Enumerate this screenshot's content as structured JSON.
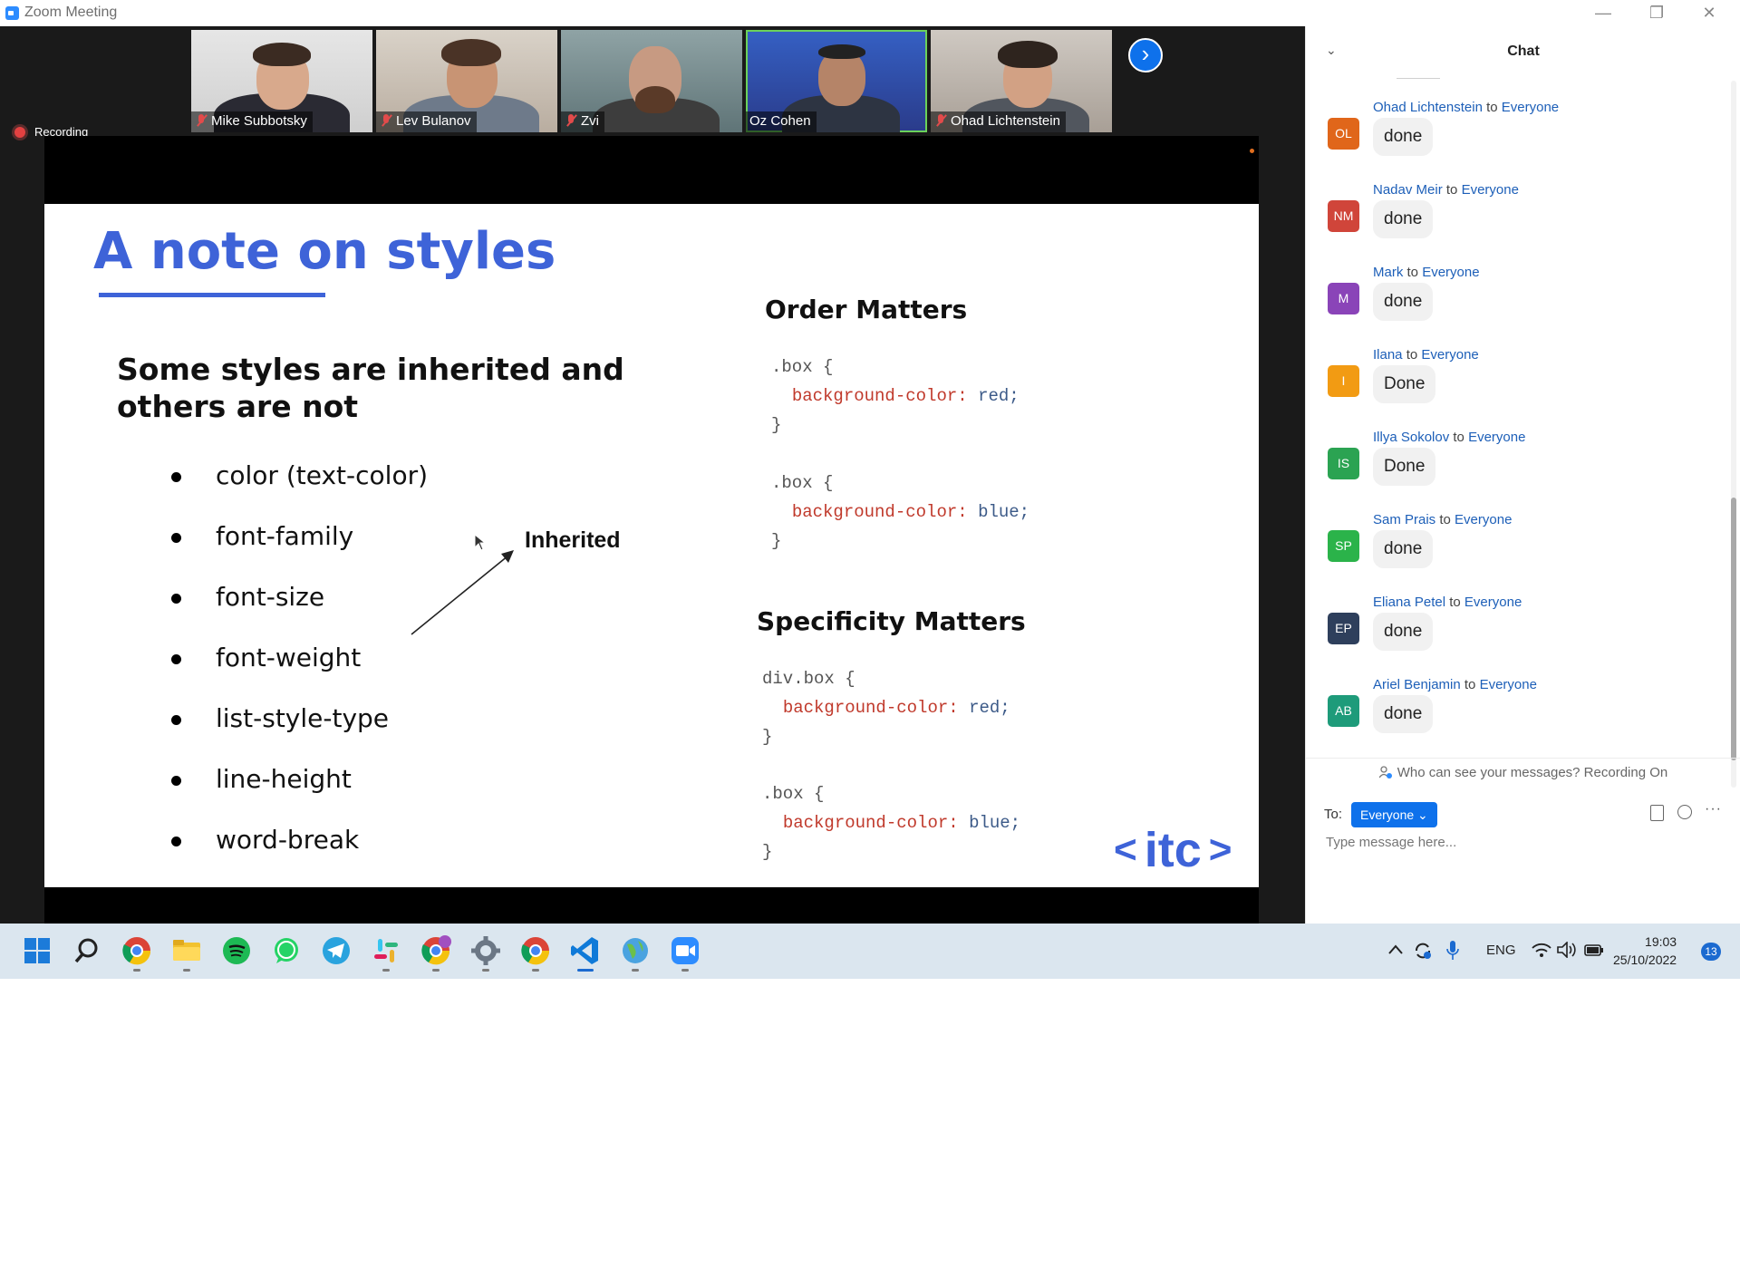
{
  "window": {
    "title": "Zoom Meeting"
  },
  "participants": [
    {
      "name": "Mike Subbotsky",
      "muted": true
    },
    {
      "name": "Lev Bulanov",
      "muted": true
    },
    {
      "name": "Zvi",
      "muted": true
    },
    {
      "name": "Oz Cohen",
      "muted": false,
      "active_speaker": true
    },
    {
      "name": "Ohad Lichtenstein",
      "muted": true
    }
  ],
  "recording": {
    "label": "Recording"
  },
  "slide": {
    "title": "A note on styles",
    "subtitle": "Some styles are inherited and others are not",
    "bullets": [
      "color (text-color)",
      "font-family",
      "font-size",
      "font-weight",
      "list-style-type",
      "line-height",
      "word-break"
    ],
    "annotation": "Inherited",
    "order_title": "Order Matters",
    "order_code": [
      {
        "selector": ".box {",
        "prop": "background-color:",
        "value": "red;",
        "close": "}"
      },
      {
        "selector": ".box {",
        "prop": "background-color:",
        "value": "blue;",
        "close": "}"
      }
    ],
    "specificity_title": "Specificity Matters",
    "specificity_code": [
      {
        "selector": "div.box {",
        "prop": "background-color:",
        "value": "red;",
        "close": "}"
      },
      {
        "selector": ".box {",
        "prop": "background-color:",
        "value": "blue;",
        "close": "}"
      }
    ],
    "logo": {
      "left": "<",
      "text": "itc",
      "right": ">"
    },
    "accent_color": "#3e63d8"
  },
  "chat": {
    "title": "Chat",
    "to_word": "to",
    "messages": [
      {
        "initials": "OL",
        "sender": "Ohad Lichtenstein",
        "to": "Everyone",
        "text": "done",
        "color": "#e0661a"
      },
      {
        "initials": "NM",
        "sender": "Nadav Meir",
        "to": "Everyone",
        "text": "done",
        "color": "#d0453a"
      },
      {
        "initials": "M",
        "sender": "Mark",
        "to": "Everyone",
        "text": "done",
        "color": "#8a44b8"
      },
      {
        "initials": "I",
        "sender": "Ilana",
        "to": "Everyone",
        "text": "Done",
        "color": "#f29b13"
      },
      {
        "initials": "IS",
        "sender": "Illya Sokolov",
        "to": "Everyone",
        "text": "Done",
        "color": "#2ba352"
      },
      {
        "initials": "SP",
        "sender": "Sam Prais",
        "to": "Everyone",
        "text": "done",
        "color": "#2bb34a"
      },
      {
        "initials": "EP",
        "sender": "Eliana Petel",
        "to": "Everyone",
        "text": "done",
        "color": "#2e3f5c"
      },
      {
        "initials": "AB",
        "sender": "Ariel Benjamin",
        "to": "Everyone",
        "text": "done",
        "color": "#1e9b7a"
      }
    ],
    "notice": "Who can see your messages? Recording On",
    "to_label": "To:",
    "recipient": "Everyone",
    "input_placeholder": "Type message here..."
  },
  "taskbar": {
    "apps": [
      "windows-start",
      "search",
      "chrome",
      "file-explorer",
      "spotify",
      "whatsapp",
      "telegram",
      "slack",
      "chrome-profile",
      "settings",
      "chrome",
      "vscode",
      "maps",
      "zoom"
    ],
    "tray_language": "ENG",
    "time": "19:03",
    "date": "25/10/2022",
    "notifications": "13"
  }
}
